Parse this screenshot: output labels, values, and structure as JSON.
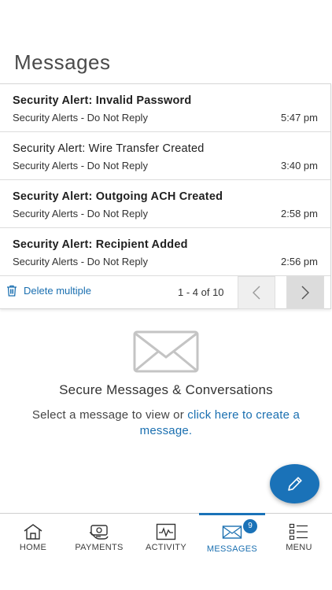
{
  "page": {
    "title": "Messages"
  },
  "messages": [
    {
      "subject": "Security Alert: Invalid Password",
      "sender": "Security Alerts - Do Not Reply",
      "time": "5:47 pm",
      "unread": true
    },
    {
      "subject": "Security Alert: Wire Transfer Created",
      "sender": "Security Alerts - Do Not Reply",
      "time": "3:40 pm",
      "unread": false
    },
    {
      "subject": "Security Alert: Outgoing ACH Created",
      "sender": "Security Alerts - Do Not Reply",
      "time": "2:58 pm",
      "unread": true
    },
    {
      "subject": "Security Alert: Recipient Added",
      "sender": "Security Alerts - Do Not Reply",
      "time": "2:56 pm",
      "unread": true
    }
  ],
  "pager": {
    "delete_label": "Delete multiple",
    "range_text": "1 - 4 of 10"
  },
  "empty_state": {
    "title": "Secure Messages & Conversations",
    "text_prefix": "Select a message to view or ",
    "link_text": "click here to create a message."
  },
  "tabs": [
    {
      "label": "HOME",
      "icon": "home-icon"
    },
    {
      "label": "PAYMENTS",
      "icon": "payments-icon"
    },
    {
      "label": "ACTIVITY",
      "icon": "activity-icon"
    },
    {
      "label": "MESSAGES",
      "icon": "envelope-icon",
      "badge": "9",
      "active": true
    },
    {
      "label": "MENU",
      "icon": "menu-list-icon"
    }
  ],
  "colors": {
    "accent": "#1a72b8",
    "link": "#1a6fb0"
  }
}
